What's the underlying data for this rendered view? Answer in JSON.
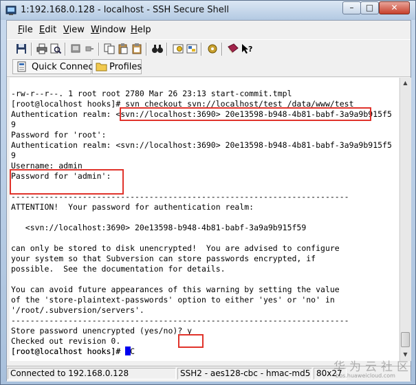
{
  "window": {
    "title": "1:192.168.0.128 - localhost - SSH Secure Shell",
    "minimize": "–",
    "maximize": "□",
    "close": "✕"
  },
  "menu": {
    "file": {
      "key": "F",
      "rest": "ile"
    },
    "edit": {
      "key": "E",
      "rest": "dit"
    },
    "view": {
      "key": "V",
      "rest": "iew"
    },
    "window": {
      "key": "W",
      "rest": "indow"
    },
    "help": {
      "key": "H",
      "rest": "elp"
    }
  },
  "toolbar2": {
    "quick_connect": "Quick Connect",
    "profiles": "Profiles"
  },
  "terminal": {
    "lines": [
      "-rw-r--r--. 1 root root 2780 Mar 26 23:13 start-commit.tmpl",
      "[root@localhost hooks]# svn checkout svn://localhost/test /data/www/test",
      "Authentication realm: <svn://localhost:3690> 20e13598-b948-4b81-babf-3a9a9b915f5",
      "9",
      "Password for 'root':",
      "Authentication realm: <svn://localhost:3690> 20e13598-b948-4b81-babf-3a9a9b915f5",
      "9",
      "Username: admin",
      "Password for 'admin':",
      "",
      "-----------------------------------------------------------------------",
      "ATTENTION!  Your password for authentication realm:",
      "",
      "   <svn://localhost:3690> 20e13598-b948-4b81-babf-3a9a9b915f59",
      "",
      "can only be stored to disk unencrypted!  You are advised to configure",
      "your system so that Subversion can store passwords encrypted, if",
      "possible.  See the documentation for details.",
      "",
      "You can avoid future appearances of this warning by setting the value",
      "of the 'store-plaintext-passwords' option to either 'yes' or 'no' in",
      "'/root/.subversion/servers'.",
      "-----------------------------------------------------------------------",
      "Store password unencrypted (yes/no)? y",
      "Checked out revision 0.",
      "[root@localhost hooks]# ^C"
    ],
    "prompt": "[root@localhost hooks]# "
  },
  "status": {
    "connection": "Connected to 192.168.0.128",
    "cipher": "SSH2 - aes128-cbc - hmac-md5",
    "size": "80x27"
  },
  "watermark": {
    "text": "华为云社区",
    "url": "bbs.huaweicloud.com"
  },
  "colors": {
    "highlight": "#e0322a",
    "cursor": "#0000ee"
  }
}
